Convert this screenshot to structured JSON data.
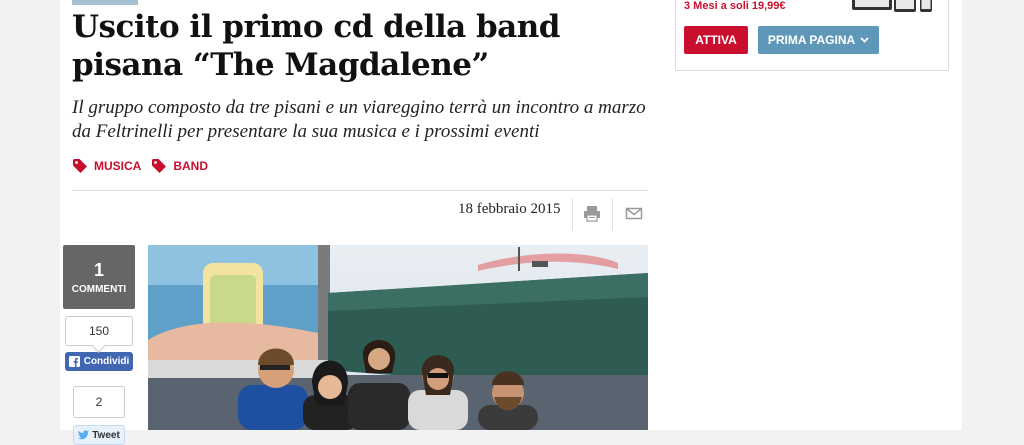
{
  "article": {
    "title": "Uscito il primo cd della band pisana “The Magdalene”",
    "subtitle": "Il gruppo composto da tre pisani e un viareggino terrà un incontro a marzo da Feltrinelli per presentare la sua musica e i prossimi eventi",
    "tags": [
      "MUSICA",
      "BAND"
    ],
    "date": "18 febbraio 2015"
  },
  "social": {
    "comments_count": "1",
    "comments_label": "COMMENTI",
    "facebook_count": "150",
    "facebook_label": "Condividi",
    "twitter_count": "2",
    "twitter_label": "Tweet"
  },
  "sidebar": {
    "promo_text": "3 Mesi a soli 19,99€",
    "attiva_label": "ATTIVA",
    "prima_pagina_label": "PRIMA PAGINA"
  },
  "icons": {
    "tag": "tag-icon",
    "print": "print-icon",
    "email": "email-icon",
    "facebook": "facebook-icon",
    "twitter": "twitter-icon",
    "chevron": "chevron-down-icon"
  },
  "colors": {
    "accent_red": "#c8102e",
    "button_blue": "#5e97b7",
    "facebook_blue": "#4267b2"
  }
}
